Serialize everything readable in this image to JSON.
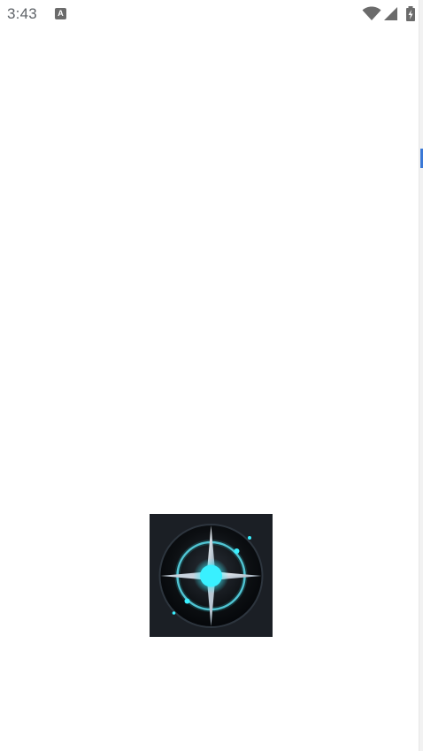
{
  "status_bar": {
    "time": "3:43",
    "notification_icon": "a-notification-icon",
    "wifi_icon": "wifi-icon",
    "signal_icon": "cellular-signal-icon",
    "battery_icon": "battery-charging-icon"
  },
  "splash": {
    "logo_icon": "compass-logo-icon",
    "colors": {
      "background": "#ffffff",
      "logo_bg": "#1b1f25",
      "glow": "#39f0ff"
    }
  }
}
